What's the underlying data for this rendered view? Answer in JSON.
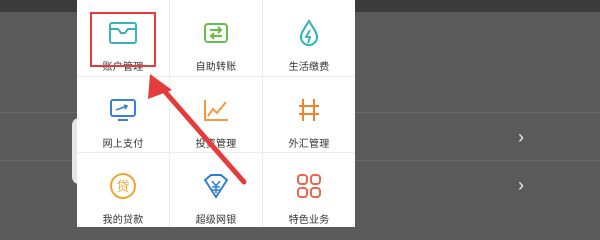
{
  "background": {
    "chevron_symbol": "›"
  },
  "grid": {
    "items": [
      {
        "label": "账户管理",
        "icon": "account-tray-icon",
        "color": "#37b2b7"
      },
      {
        "label": "自助转账",
        "icon": "transfer-icon",
        "color": "#69be4b"
      },
      {
        "label": "生活缴费",
        "icon": "water-drop-icon",
        "color": "#28b3b6"
      },
      {
        "label": "网上支付",
        "icon": "online-pay-icon",
        "color": "#3c7fd8"
      },
      {
        "label": "投资管理",
        "icon": "chart-line-icon",
        "color": "#f39a3b"
      },
      {
        "label": "外汇管理",
        "icon": "currency-exchange-icon",
        "color": "#f2832a"
      },
      {
        "label": "我的贷款",
        "icon": "loan-icon",
        "color": "#f2a630"
      },
      {
        "label": "超级网银",
        "icon": "yuan-diamond-icon",
        "color": "#2f7fd1"
      },
      {
        "label": "特色业务",
        "icon": "four-squares-icon",
        "color": "#e9664f"
      }
    ]
  },
  "annotation": {
    "highlight_color": "#e63b3b",
    "target": "账户管理"
  }
}
